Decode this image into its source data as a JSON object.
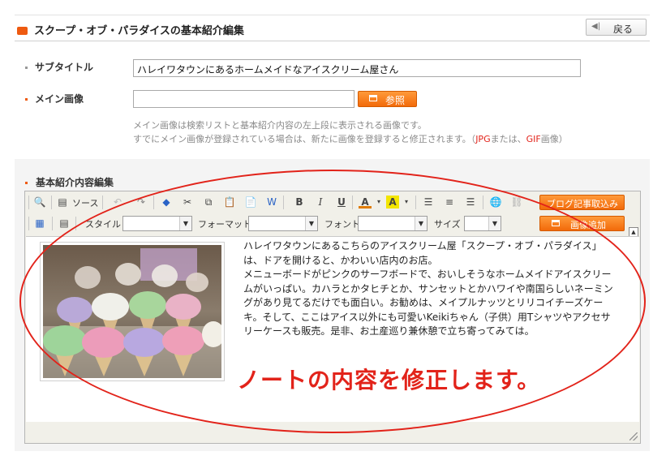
{
  "header": {
    "title": "スクープ・オブ・パラダイスの基本紹介編集",
    "back_label": "戻る"
  },
  "form": {
    "subtitle_label": "サブタイトル",
    "subtitle_value": "ハレイワタウンにあるホームメイドなアイスクリーム屋さん",
    "main_image_label": "メイン画像",
    "main_image_value": "",
    "browse_label": "参照",
    "help_line1": "メイン画像は検索リストと基本紹介内容の左上段に表示される画像です。",
    "help_line2_pre": "すでにメイン画像が登録されている場合は、新たに画像を登録すると修正されます。（",
    "help_jpg": "JPG",
    "help_or": "または、",
    "help_gif": "GIF",
    "help_post": "画像）"
  },
  "editor": {
    "section_title": "基本紹介内容編集",
    "source_label": "ソース",
    "bold": "B",
    "italic": "I",
    "underline": "U",
    "text_color_icon": "A",
    "bg_color_icon": "A",
    "blog_import_label": "ブログ記事取込み",
    "style_label": "スタイル",
    "format_label": "フォーマット",
    "font_label": "フォント",
    "size_label": "サイズ",
    "add_image_label": "画像追加",
    "style_value": "",
    "format_value": "",
    "font_value": "",
    "size_value": "",
    "content_paragraph1": "ハレイワタウンにあるこちらのアイスクリーム屋「スクープ・オブ・パラダイス」は、ドアを開けると、かわいい店内のお店。",
    "content_paragraph2": "メニューボードがピンクのサーフボードで、おいしそうなホームメイドアイスクリームがいっぱい。カハラとかタヒチとか、サンセットとかハワイや南国らしいネーミングがあり見てるだけでも面白い。お勧めは、メイプルナッツとリリコイチーズケーキ。そして、ここはアイス以外にも可愛いKeikiちゃん（子供）用Tシャツやアクセサリーケースも販売。是非、お土産巡り兼休憩で立ち寄ってみては。"
  },
  "annotation": {
    "text": "ノートの内容を修正します。",
    "color": "#e2231a"
  },
  "colors": {
    "accent": "#f26a0a",
    "header_square": "#ee5a10"
  }
}
